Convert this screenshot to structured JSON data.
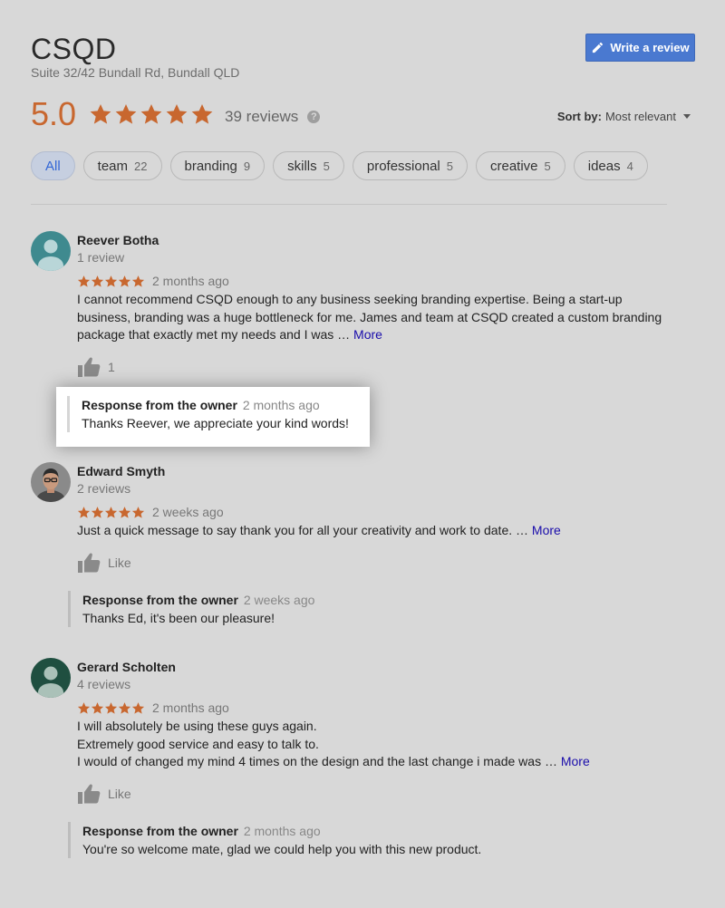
{
  "business": {
    "name": "CSQD",
    "address": "Suite 32/42 Bundall Rd, Bundall QLD",
    "write_review_label": "Write a review",
    "rating": "5.0",
    "review_count": "39 reviews",
    "help_icon": "?"
  },
  "sort": {
    "label": "Sort by:",
    "value": "Most relevant"
  },
  "filters": [
    {
      "label": "All",
      "count": ""
    },
    {
      "label": "team",
      "count": "22"
    },
    {
      "label": "branding",
      "count": "9"
    },
    {
      "label": "skills",
      "count": "5"
    },
    {
      "label": "professional",
      "count": "5"
    },
    {
      "label": "creative",
      "count": "5"
    },
    {
      "label": "ideas",
      "count": "4"
    }
  ],
  "reviews": [
    {
      "name": "Reever Botha",
      "meta": "1 review",
      "date": "2 months ago",
      "text_lines": [
        "I cannot recommend CSQD enough to any business seeking branding expertise. Being a start-up",
        "business, branding was a huge bottleneck for me. James and team at CSQD created a custom branding",
        "package that exactly met my needs and I was … "
      ],
      "more": "More",
      "like_label": "1",
      "response_title": "Response from the owner",
      "response_date": "2 months ago",
      "response_text": "Thanks Reever, we appreciate your kind words!"
    },
    {
      "name": "Edward Smyth",
      "meta": "2 reviews",
      "date": "2 weeks ago",
      "text_lines": [
        "Just a quick message to say thank you for all your creativity and work to date. … "
      ],
      "more": "More",
      "like_label": "Like",
      "response_title": "Response from the owner",
      "response_date": "2 weeks ago",
      "response_text": "Thanks Ed, it's been our pleasure!"
    },
    {
      "name": "Gerard Scholten",
      "meta": "4 reviews",
      "date": "2 months ago",
      "text_lines": [
        "I will absolutely be using these guys again.",
        "Extremely good service and easy to talk to.",
        "I would of changed my mind 4 times on the design and the last change i made was … "
      ],
      "more": "More",
      "like_label": "Like",
      "response_title": "Response from the owner",
      "response_date": "2 months ago",
      "response_text": "You're so welcome mate, glad we could help you with this new product."
    }
  ],
  "colors": {
    "star": "#c8672f",
    "accent": "#4a79d0",
    "link": "#1a0dab"
  }
}
